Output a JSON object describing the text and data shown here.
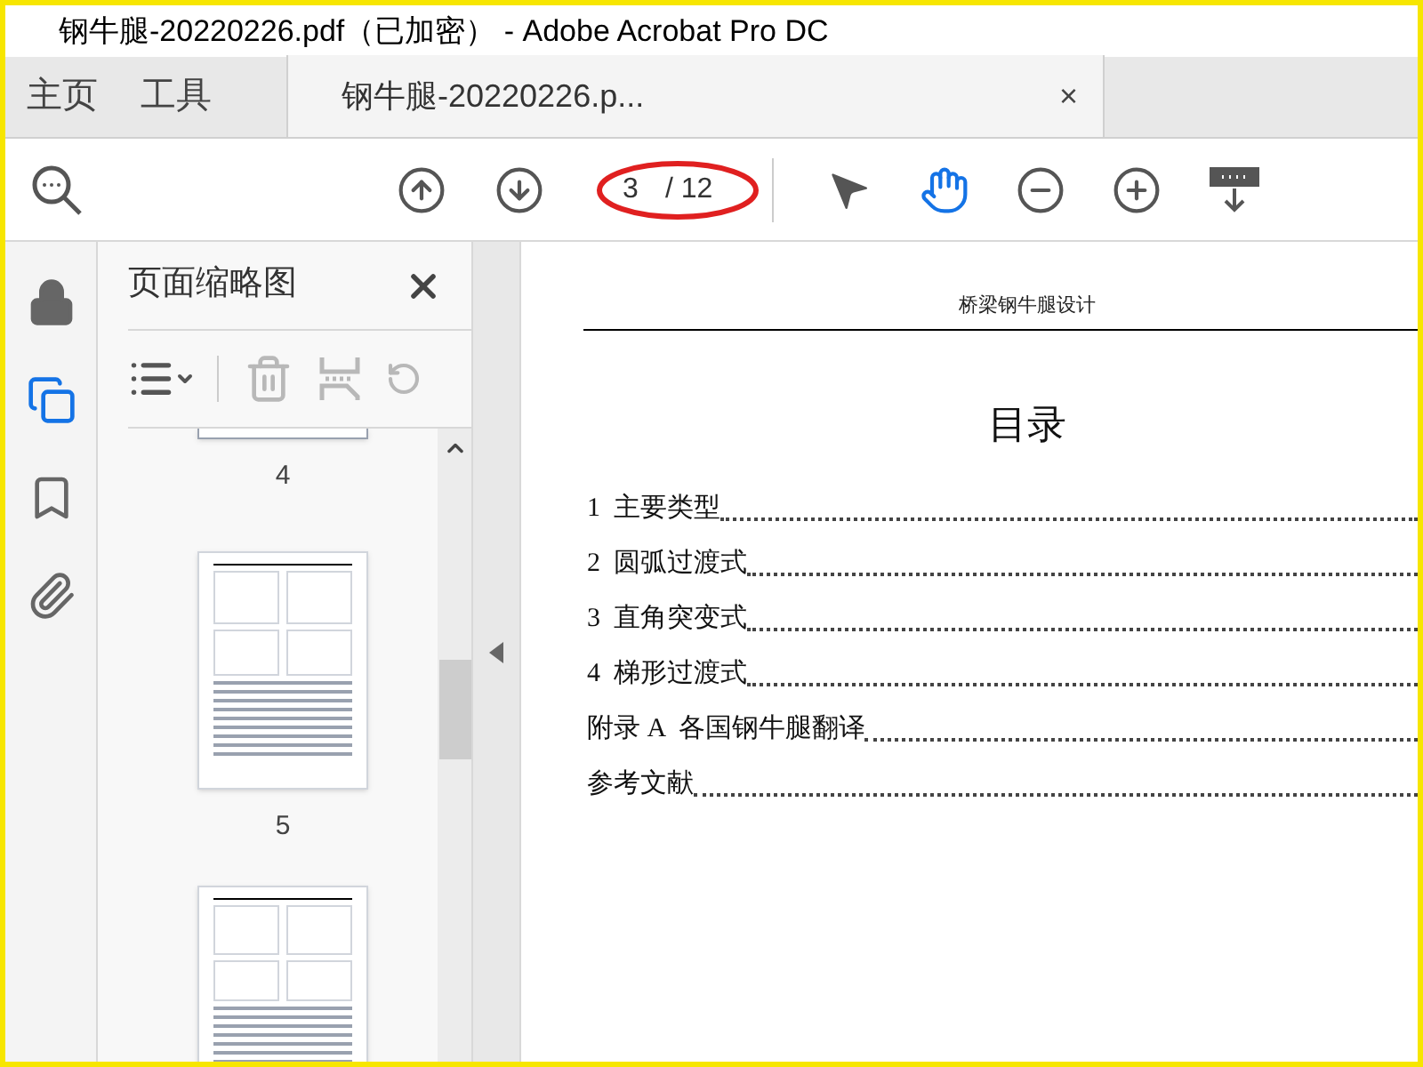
{
  "window": {
    "title": "钢牛腿-20220226.pdf（已加密） - Adobe Acrobat Pro DC"
  },
  "tabs": [
    {
      "label": "主页",
      "selected": false,
      "kind": "nav"
    },
    {
      "label": "工具",
      "selected": false,
      "kind": "nav"
    },
    {
      "label": "钢牛腿-20220226.p...",
      "selected": true,
      "kind": "document",
      "close": "×"
    }
  ],
  "toolbar": {
    "page_number": "3",
    "page_total": "/ 12",
    "tools": [
      {
        "kind": "pointer",
        "selected": false
      },
      {
        "kind": "hand",
        "selected": true
      }
    ]
  },
  "left_rail": [
    {
      "kind": "lock",
      "selected": false
    },
    {
      "kind": "pages",
      "selected": true
    },
    {
      "kind": "bookmark",
      "selected": false
    },
    {
      "kind": "attachment",
      "selected": false
    }
  ],
  "thumbnails_panel": {
    "title": "页面缩略图",
    "actions": [
      {
        "kind": "options",
        "disabled": false
      },
      {
        "kind": "delete",
        "disabled": true
      },
      {
        "kind": "extract",
        "disabled": true
      },
      {
        "kind": "rotate",
        "disabled": true
      }
    ],
    "thumbnails": [
      {
        "label": "4",
        "kind": "cut"
      },
      {
        "label": "5",
        "kind": "full"
      },
      {
        "kind": "partial"
      }
    ]
  },
  "document": {
    "header": "桥梁钢牛腿设计",
    "heading": "目录",
    "toc": [
      {
        "label": "1  主要类型"
      },
      {
        "label": "2  圆弧过渡式"
      },
      {
        "label": "3  直角突变式"
      },
      {
        "label": "4  梯形过渡式"
      },
      {
        "label": "附录 A  各国钢牛腿翻译"
      },
      {
        "label": "参考文献"
      }
    ]
  }
}
